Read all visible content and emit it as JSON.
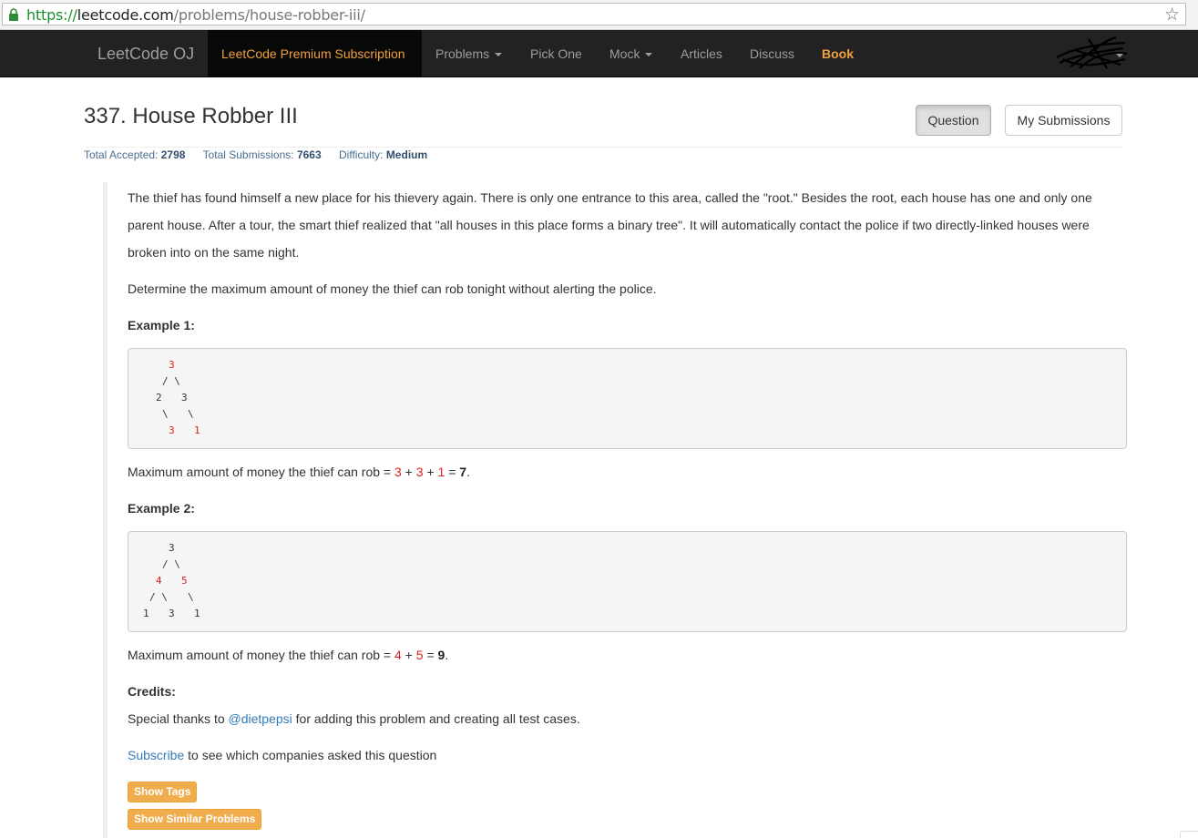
{
  "browser": {
    "url_scheme": "https://",
    "url_host": "leetcode.com",
    "url_path": "/problems/house-robber-iii/",
    "bookmark_icon": "star-icon",
    "secure_icon": "lock-icon"
  },
  "navbar": {
    "brand": "LeetCode OJ",
    "premium": "LeetCode Premium Subscription",
    "items": [
      {
        "label": "Problems",
        "dropdown": true
      },
      {
        "label": "Pick One",
        "dropdown": false
      },
      {
        "label": "Mock",
        "dropdown": true
      },
      {
        "label": "Articles",
        "dropdown": false
      },
      {
        "label": "Discuss",
        "dropdown": false
      }
    ],
    "book": "Book",
    "accent_color": "#f0a03c"
  },
  "problem": {
    "title": "337. House Robber III",
    "tab_question": "Question",
    "tab_submissions": "My Submissions",
    "stats": {
      "accepted_label": "Total Accepted:",
      "accepted_value": "2798",
      "submissions_label": "Total Submissions:",
      "submissions_value": "7663",
      "difficulty_label": "Difficulty:",
      "difficulty_value": "Medium"
    },
    "description": "The thief has found himself a new place for his thievery again. There is only one entrance to this area, called the \"root.\" Besides the root, each house has one and only one parent house. After a tour, the smart thief realized that \"all houses in this place forms a binary tree\". It will automatically contact the police if two directly-linked houses were broken into on the same night.",
    "task": "Determine the maximum amount of money the thief can rob tonight without alerting the police.",
    "example1": {
      "heading": "Example 1:",
      "tree_values": [
        "3",
        "2",
        "3",
        "3",
        "1"
      ],
      "result_prefix": "Maximum amount of money the thief can rob = ",
      "terms": [
        "3",
        "3",
        "1"
      ],
      "plus": "+",
      "equals": "=",
      "total": "7",
      "period": "."
    },
    "example2": {
      "heading": "Example 2:",
      "tree_values": [
        "3",
        "4",
        "5",
        "1",
        "3",
        "1"
      ],
      "result_prefix": "Maximum amount of money the thief can rob = ",
      "terms": [
        "4",
        "5"
      ],
      "plus": "+",
      "equals": "=",
      "total": "9",
      "period": "."
    },
    "credits": {
      "heading": "Credits:",
      "prefix": "Special thanks to ",
      "user": "@dietpepsi",
      "suffix": " for adding this problem and creating all test cases."
    },
    "subscribe": {
      "link": "Subscribe",
      "text": " to see which companies asked this question"
    },
    "show_tags": "Show Tags",
    "show_similar": "Show Similar Problems",
    "highlight_color": "#e02020",
    "button_color": "#f0ad4e"
  }
}
